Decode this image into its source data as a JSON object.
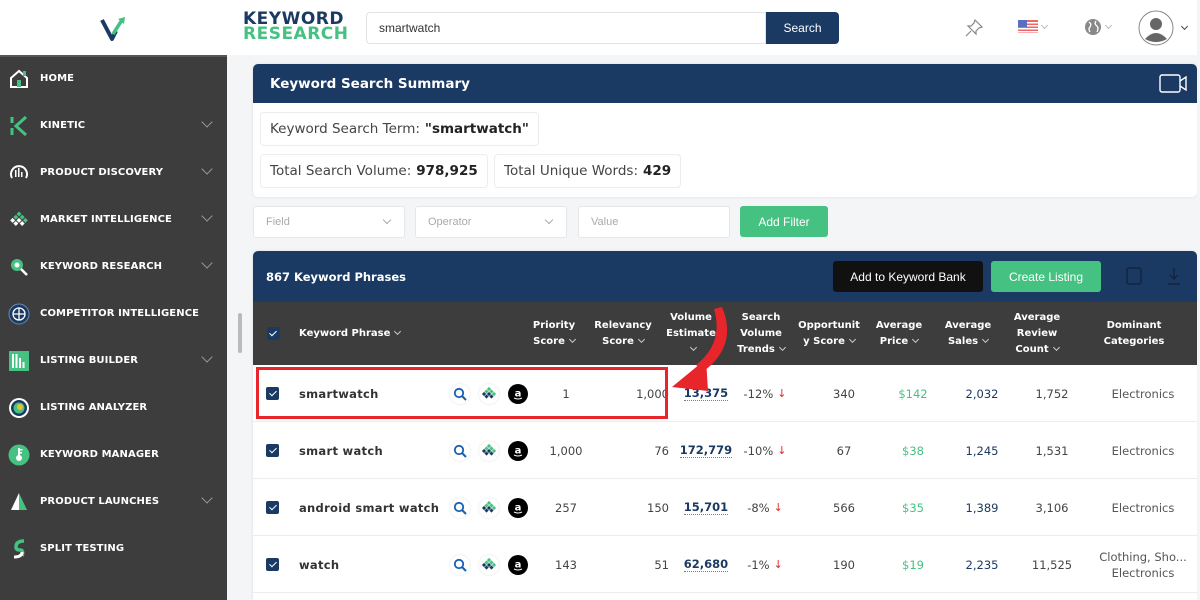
{
  "app": {
    "brand_line1": "KEYWORD",
    "brand_line2": "RESEARCH",
    "colors": {
      "navy": "#1b3a63",
      "green": "#45c281",
      "sidebar": "#3d3d3d",
      "red": "#e8252a"
    }
  },
  "search": {
    "value": "smartwatch",
    "button_label": "Search"
  },
  "top_icons": [
    "pin-icon",
    "us-flag-icon",
    "globe-icon",
    "user-avatar-icon"
  ],
  "sidebar": {
    "items": [
      {
        "label": "HOME",
        "icon": "home-icon",
        "expandable": false
      },
      {
        "label": "KINETIC",
        "icon": "kinetic-icon",
        "expandable": true
      },
      {
        "label": "PRODUCT DISCOVERY",
        "icon": "product-discovery-icon",
        "expandable": true
      },
      {
        "label": "MARKET INTELLIGENCE",
        "icon": "market-intelligence-icon",
        "expandable": true
      },
      {
        "label": "KEYWORD RESEARCH",
        "icon": "keyword-research-icon",
        "expandable": true
      },
      {
        "label": "COMPETITOR INTELLIGENCE",
        "icon": "competitor-intelligence-icon",
        "expandable": false
      },
      {
        "label": "LISTING BUILDER",
        "icon": "listing-builder-icon",
        "expandable": true
      },
      {
        "label": "LISTING ANALYZER",
        "icon": "listing-analyzer-icon",
        "expandable": false
      },
      {
        "label": "KEYWORD MANAGER",
        "icon": "keyword-manager-icon",
        "expandable": false
      },
      {
        "label": "PRODUCT LAUNCHES",
        "icon": "product-launches-icon",
        "expandable": true
      },
      {
        "label": "SPLIT TESTING",
        "icon": "split-testing-icon",
        "expandable": false
      }
    ]
  },
  "summary": {
    "title": "Keyword Search Summary",
    "term_label": "Keyword Search Term:",
    "term_value": "\"smartwatch\"",
    "volume_label": "Total Search Volume:",
    "volume_value": "978,925",
    "unique_label": "Total Unique Words:",
    "unique_value": "429"
  },
  "filters": {
    "field_placeholder": "Field",
    "operator_placeholder": "Operator",
    "value_placeholder": "Value",
    "add_label": "Add Filter"
  },
  "table": {
    "title": "867 Keyword Phrases",
    "add_to_bank_label": "Add to Keyword Bank",
    "create_listing_label": "Create Listing",
    "columns": [
      "Keyword Phrase",
      "Priority Score",
      "Relevancy Score",
      "Volume Estimate",
      "Search Volume Trends",
      "Opportunity Score",
      "Average Price",
      "Average Sales",
      "Average Review Count",
      "Dominant Categories"
    ],
    "rows": [
      {
        "keyword": "smartwatch",
        "priority": "1",
        "relevancy": "1,000",
        "volume": "13,375",
        "trend": "-12%",
        "opportunity": "340",
        "price": "$142",
        "sales": "2,032",
        "reviews": "1,752",
        "categories": "Electronics",
        "highlighted": true
      },
      {
        "keyword": "smart watch",
        "priority": "1,000",
        "relevancy": "76",
        "volume": "172,779",
        "trend": "-10%",
        "opportunity": "67",
        "price": "$38",
        "sales": "1,245",
        "reviews": "1,531",
        "categories": "Electronics"
      },
      {
        "keyword": "android smart watch",
        "priority": "257",
        "relevancy": "150",
        "volume": "15,701",
        "trend": "-8%",
        "opportunity": "566",
        "price": "$35",
        "sales": "1,389",
        "reviews": "3,106",
        "categories": "Electronics"
      },
      {
        "keyword": "watch",
        "priority": "143",
        "relevancy": "51",
        "volume": "62,680",
        "trend": "-1%",
        "opportunity": "190",
        "price": "$19",
        "sales": "2,235",
        "reviews": "11,525",
        "categories": "Clothing, Sho...",
        "categories2": "Electronics"
      }
    ]
  }
}
